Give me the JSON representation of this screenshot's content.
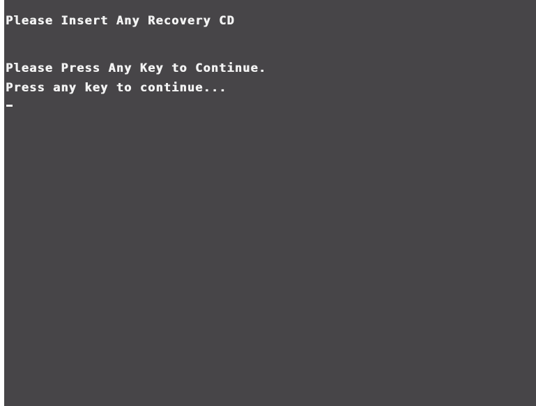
{
  "console": {
    "background_color": "#474548",
    "text_color": "#f2f2f2",
    "lines": [
      "Please Insert Any Recovery CD",
      "Please Press Any Key to Continue.",
      "Press any key to continue..."
    ],
    "cursor": "_"
  }
}
